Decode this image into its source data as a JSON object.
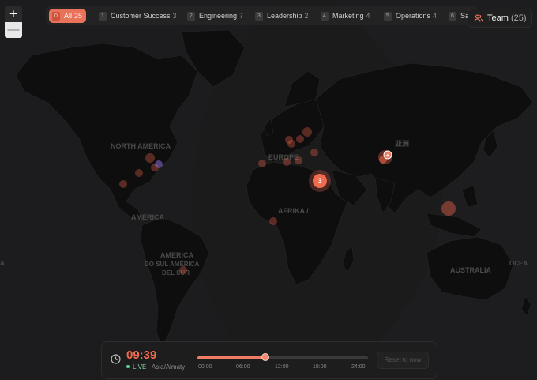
{
  "zoom": {
    "in_label": "+",
    "out_label": "—"
  },
  "tabs": [
    {
      "num": "0",
      "label": "All",
      "count": "25",
      "active": true
    },
    {
      "num": "1",
      "label": "Customer Success",
      "count": "3"
    },
    {
      "num": "2",
      "label": "Engineering",
      "count": "7"
    },
    {
      "num": "3",
      "label": "Leadership",
      "count": "2"
    },
    {
      "num": "4",
      "label": "Marketing",
      "count": "4"
    },
    {
      "num": "5",
      "label": "Operations",
      "count": "4"
    },
    {
      "num": "6",
      "label": "Sa",
      "count": ""
    }
  ],
  "team": {
    "label": "Team",
    "count": "(25)"
  },
  "map_labels": {
    "north_america": "NORTH AMERICA",
    "america": "AMERICA",
    "south_america": "AMERICA",
    "south_america_local": "DO SUL AMÉRICA",
    "south_america_local2": "DEL SUR",
    "europe": "EUROPE",
    "africa": "AFRIKA /",
    "asia": "亚洲",
    "australia": "AUSTRALIA",
    "ocean_left": "A",
    "ocean_right": "OCEA"
  },
  "clusters": {
    "middle_east_count": "3",
    "asia_count": "+"
  },
  "timebar": {
    "time": "09:39",
    "live_label": "LIVE",
    "timezone": "Asia/Almaty",
    "progress": 0.4,
    "ticks": [
      "00:00",
      "06:00",
      "12:00",
      "18:00",
      "24:00"
    ],
    "reset_label": "Reset to now"
  },
  "colors": {
    "accent": "#f26b4e",
    "live": "#5ed196",
    "marker": "#e8624a"
  }
}
